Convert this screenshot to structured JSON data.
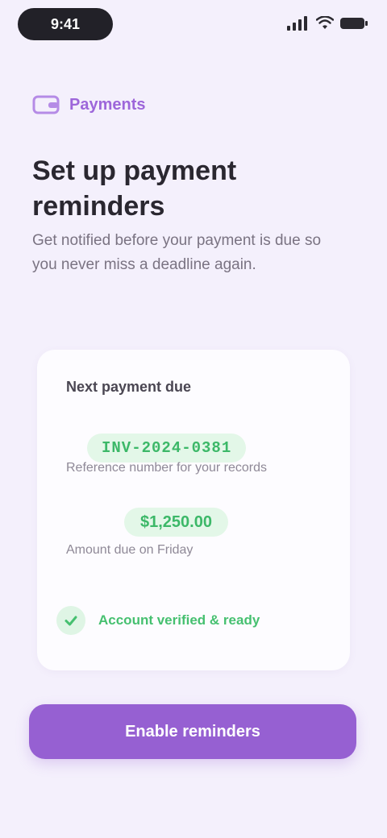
{
  "status_bar": {
    "time": "9:41",
    "icons": [
      "signal-icon",
      "wifi-icon",
      "battery-icon"
    ]
  },
  "header": {
    "eyebrow": "Payments",
    "eyebrow_icon": "wallet-icon",
    "title": "Set up payment reminders",
    "subtitle": "Get notified before your payment is due so you never miss a deadline again."
  },
  "card": {
    "label": "Next payment due",
    "code": "INV-2024-0381",
    "hint": "Reference number for your records",
    "amount": "$1,250.00",
    "hint2": "Amount due on Friday",
    "verified_text": "Account verified & ready",
    "verified_icon": "check-icon"
  },
  "actions": {
    "primary_label": "Enable reminders"
  },
  "colors": {
    "background": "#f4f0fc",
    "accent": "#9660d2",
    "success": "#3cb868",
    "success_bg": "#e3f7e8"
  }
}
